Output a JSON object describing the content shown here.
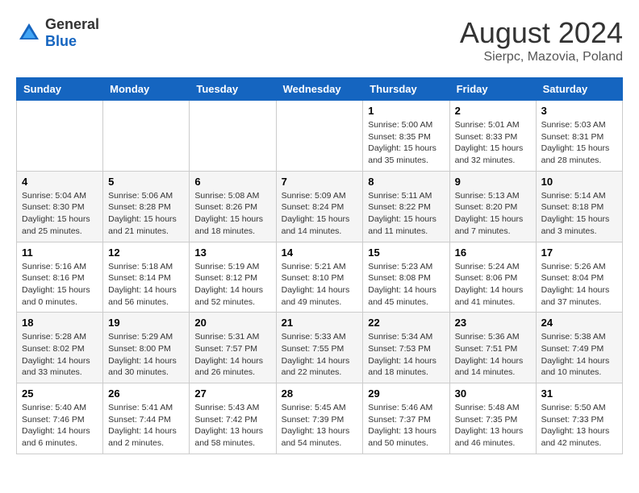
{
  "header": {
    "logo": {
      "general": "General",
      "blue": "Blue"
    },
    "title": "August 2024",
    "location": "Sierpc, Mazovia, Poland"
  },
  "weekdays": [
    "Sunday",
    "Monday",
    "Tuesday",
    "Wednesday",
    "Thursday",
    "Friday",
    "Saturday"
  ],
  "weeks": [
    [
      {
        "day": "",
        "info": ""
      },
      {
        "day": "",
        "info": ""
      },
      {
        "day": "",
        "info": ""
      },
      {
        "day": "",
        "info": ""
      },
      {
        "day": "1",
        "info": "Sunrise: 5:00 AM\nSunset: 8:35 PM\nDaylight: 15 hours\nand 35 minutes."
      },
      {
        "day": "2",
        "info": "Sunrise: 5:01 AM\nSunset: 8:33 PM\nDaylight: 15 hours\nand 32 minutes."
      },
      {
        "day": "3",
        "info": "Sunrise: 5:03 AM\nSunset: 8:31 PM\nDaylight: 15 hours\nand 28 minutes."
      }
    ],
    [
      {
        "day": "4",
        "info": "Sunrise: 5:04 AM\nSunset: 8:30 PM\nDaylight: 15 hours\nand 25 minutes."
      },
      {
        "day": "5",
        "info": "Sunrise: 5:06 AM\nSunset: 8:28 PM\nDaylight: 15 hours\nand 21 minutes."
      },
      {
        "day": "6",
        "info": "Sunrise: 5:08 AM\nSunset: 8:26 PM\nDaylight: 15 hours\nand 18 minutes."
      },
      {
        "day": "7",
        "info": "Sunrise: 5:09 AM\nSunset: 8:24 PM\nDaylight: 15 hours\nand 14 minutes."
      },
      {
        "day": "8",
        "info": "Sunrise: 5:11 AM\nSunset: 8:22 PM\nDaylight: 15 hours\nand 11 minutes."
      },
      {
        "day": "9",
        "info": "Sunrise: 5:13 AM\nSunset: 8:20 PM\nDaylight: 15 hours\nand 7 minutes."
      },
      {
        "day": "10",
        "info": "Sunrise: 5:14 AM\nSunset: 8:18 PM\nDaylight: 15 hours\nand 3 minutes."
      }
    ],
    [
      {
        "day": "11",
        "info": "Sunrise: 5:16 AM\nSunset: 8:16 PM\nDaylight: 15 hours\nand 0 minutes."
      },
      {
        "day": "12",
        "info": "Sunrise: 5:18 AM\nSunset: 8:14 PM\nDaylight: 14 hours\nand 56 minutes."
      },
      {
        "day": "13",
        "info": "Sunrise: 5:19 AM\nSunset: 8:12 PM\nDaylight: 14 hours\nand 52 minutes."
      },
      {
        "day": "14",
        "info": "Sunrise: 5:21 AM\nSunset: 8:10 PM\nDaylight: 14 hours\nand 49 minutes."
      },
      {
        "day": "15",
        "info": "Sunrise: 5:23 AM\nSunset: 8:08 PM\nDaylight: 14 hours\nand 45 minutes."
      },
      {
        "day": "16",
        "info": "Sunrise: 5:24 AM\nSunset: 8:06 PM\nDaylight: 14 hours\nand 41 minutes."
      },
      {
        "day": "17",
        "info": "Sunrise: 5:26 AM\nSunset: 8:04 PM\nDaylight: 14 hours\nand 37 minutes."
      }
    ],
    [
      {
        "day": "18",
        "info": "Sunrise: 5:28 AM\nSunset: 8:02 PM\nDaylight: 14 hours\nand 33 minutes."
      },
      {
        "day": "19",
        "info": "Sunrise: 5:29 AM\nSunset: 8:00 PM\nDaylight: 14 hours\nand 30 minutes."
      },
      {
        "day": "20",
        "info": "Sunrise: 5:31 AM\nSunset: 7:57 PM\nDaylight: 14 hours\nand 26 minutes."
      },
      {
        "day": "21",
        "info": "Sunrise: 5:33 AM\nSunset: 7:55 PM\nDaylight: 14 hours\nand 22 minutes."
      },
      {
        "day": "22",
        "info": "Sunrise: 5:34 AM\nSunset: 7:53 PM\nDaylight: 14 hours\nand 18 minutes."
      },
      {
        "day": "23",
        "info": "Sunrise: 5:36 AM\nSunset: 7:51 PM\nDaylight: 14 hours\nand 14 minutes."
      },
      {
        "day": "24",
        "info": "Sunrise: 5:38 AM\nSunset: 7:49 PM\nDaylight: 14 hours\nand 10 minutes."
      }
    ],
    [
      {
        "day": "25",
        "info": "Sunrise: 5:40 AM\nSunset: 7:46 PM\nDaylight: 14 hours\nand 6 minutes."
      },
      {
        "day": "26",
        "info": "Sunrise: 5:41 AM\nSunset: 7:44 PM\nDaylight: 14 hours\nand 2 minutes."
      },
      {
        "day": "27",
        "info": "Sunrise: 5:43 AM\nSunset: 7:42 PM\nDaylight: 13 hours\nand 58 minutes."
      },
      {
        "day": "28",
        "info": "Sunrise: 5:45 AM\nSunset: 7:39 PM\nDaylight: 13 hours\nand 54 minutes."
      },
      {
        "day": "29",
        "info": "Sunrise: 5:46 AM\nSunset: 7:37 PM\nDaylight: 13 hours\nand 50 minutes."
      },
      {
        "day": "30",
        "info": "Sunrise: 5:48 AM\nSunset: 7:35 PM\nDaylight: 13 hours\nand 46 minutes."
      },
      {
        "day": "31",
        "info": "Sunrise: 5:50 AM\nSunset: 7:33 PM\nDaylight: 13 hours\nand 42 minutes."
      }
    ]
  ]
}
